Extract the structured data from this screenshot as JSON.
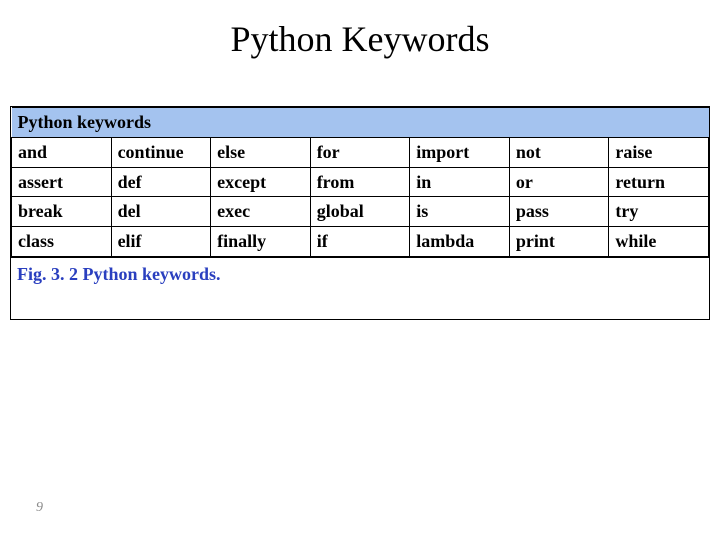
{
  "slide": {
    "title": "Python Keywords",
    "page_number": "9"
  },
  "table": {
    "header": "Python keywords",
    "caption": "Fig. 3. 2 Python keywords.",
    "rows": [
      [
        "and",
        "continue",
        "else",
        "for",
        "import",
        "not",
        "raise"
      ],
      [
        "assert",
        "def",
        "except",
        "from",
        "in",
        "or",
        "return"
      ],
      [
        "break",
        "del",
        "exec",
        "global",
        "is",
        "pass",
        "try"
      ],
      [
        "class",
        "elif",
        "finally",
        "if",
        "lambda",
        "print",
        "while"
      ]
    ]
  }
}
